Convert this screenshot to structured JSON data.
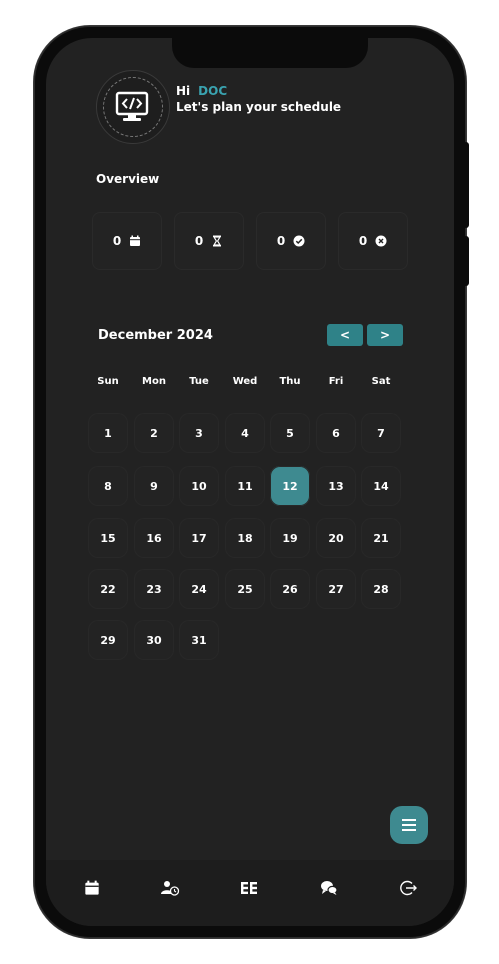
{
  "header": {
    "greeting": "Hi",
    "user_name": "DOC",
    "subtitle": "Let's plan your schedule"
  },
  "overview": {
    "title": "Overview",
    "stats": [
      {
        "value": "0",
        "icon": "calendar-icon"
      },
      {
        "value": "0",
        "icon": "hourglass-icon"
      },
      {
        "value": "0",
        "icon": "check-circle-icon"
      },
      {
        "value": "0",
        "icon": "x-circle-icon"
      }
    ]
  },
  "calendar": {
    "month_title": "December 2024",
    "prev_label": "<",
    "next_label": ">",
    "weekdays": [
      "Sun",
      "Mon",
      "Tue",
      "Wed",
      "Thu",
      "Fri",
      "Sat"
    ],
    "days": [
      "1",
      "2",
      "3",
      "4",
      "5",
      "6",
      "7",
      "8",
      "9",
      "10",
      "11",
      "12",
      "13",
      "14",
      "15",
      "16",
      "17",
      "18",
      "19",
      "20",
      "21",
      "22",
      "23",
      "24",
      "25",
      "26",
      "27",
      "28",
      "29",
      "30",
      "31"
    ],
    "selected_day": "12"
  },
  "colors": {
    "accent": "#3e8a90",
    "background": "#222222",
    "tile": "#232323",
    "name_accent": "#3aa3b0"
  },
  "bottom_nav": [
    "calendar-icon",
    "user-clock-icon",
    "grid-icon",
    "chat-icon",
    "logout-icon"
  ]
}
